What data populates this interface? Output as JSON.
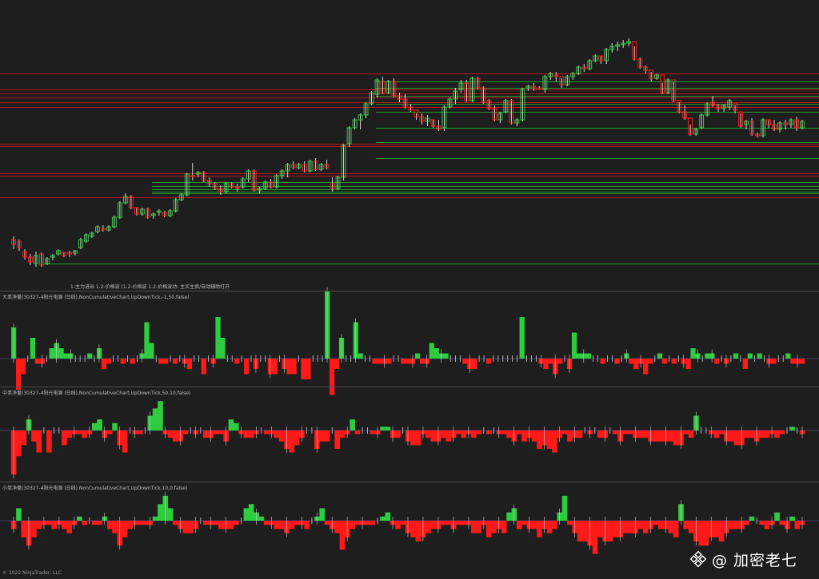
{
  "colors": {
    "background": "#1e1e1e",
    "up": "#2ecc40",
    "down": "#ff1a1a",
    "level_red": "#b8141a",
    "level_green": "#1f9a2c",
    "wick": "#d8d8d8",
    "separator": "#4a4a4a"
  },
  "price_panel": {
    "legend": "1-主力进出 1.2-价格波 (1.2-价格波 1.2-价格波动: 主买主卖/自动辅助打开"
  },
  "panels": [
    {
      "label": "大单净量(30327-4阳光电源 (日线),NonCumulativeChart,UpDownTick,-1,50,false)"
    },
    {
      "label": "中单净量(30327-4阳光电源 (日线),NonCumulativeChart,UpDownTick,50,10,false)"
    },
    {
      "label": "小单净量(30327-4阳光电源 (日线),NonCumulativeChart,UpDownTick,10,0,false)"
    }
  ],
  "footer": {
    "copyright": "© 2022 NinjaTrader, LLC"
  },
  "watermark": {
    "icon": "binance-logo-icon",
    "text": "@ 加密老七"
  },
  "chart_data": {
    "type": "candlestick",
    "grid": false,
    "candles": [
      [
        300,
        296,
        312,
        306
      ],
      [
        302,
        300,
        314,
        310
      ],
      [
        315,
        312,
        325,
        322
      ],
      [
        322,
        318,
        332,
        328
      ],
      [
        330,
        315,
        334,
        320
      ],
      [
        318,
        316,
        334,
        332
      ],
      [
        330,
        322,
        332,
        324
      ],
      [
        322,
        318,
        326,
        320
      ],
      [
        318,
        312,
        320,
        314
      ],
      [
        316,
        316,
        322,
        320
      ],
      [
        316,
        314,
        322,
        318
      ],
      [
        317,
        313,
        320,
        314
      ],
      [
        310,
        298,
        312,
        300
      ],
      [
        302,
        292,
        304,
        294
      ],
      [
        296,
        290,
        298,
        292
      ],
      [
        290,
        282,
        292,
        284
      ],
      [
        286,
        282,
        290,
        288
      ],
      [
        288,
        282,
        290,
        284
      ],
      [
        284,
        270,
        286,
        272
      ],
      [
        272,
        252,
        274,
        254
      ],
      [
        254,
        242,
        256,
        246
      ],
      [
        246,
        244,
        262,
        260
      ],
      [
        260,
        260,
        270,
        268
      ],
      [
        268,
        260,
        270,
        262
      ],
      [
        262,
        260,
        274,
        272
      ],
      [
        270,
        266,
        274,
        268
      ],
      [
        266,
        262,
        270,
        264
      ],
      [
        266,
        264,
        272,
        270
      ],
      [
        270,
        262,
        272,
        264
      ],
      [
        264,
        248,
        266,
        250
      ],
      [
        250,
        242,
        252,
        244
      ],
      [
        244,
        216,
        246,
        218
      ],
      [
        220,
        204,
        226,
        220
      ],
      [
        218,
        214,
        222,
        216
      ],
      [
        216,
        214,
        228,
        226
      ],
      [
        226,
        222,
        234,
        230
      ],
      [
        230,
        228,
        238,
        236
      ],
      [
        236,
        232,
        244,
        240
      ],
      [
        240,
        228,
        242,
        230
      ],
      [
        230,
        228,
        236,
        234
      ],
      [
        234,
        230,
        240,
        236
      ],
      [
        234,
        222,
        236,
        224
      ],
      [
        224,
        212,
        228,
        214
      ],
      [
        214,
        212,
        240,
        238
      ],
      [
        238,
        234,
        242,
        236
      ],
      [
        236,
        226,
        238,
        228
      ],
      [
        228,
        224,
        236,
        234
      ],
      [
        234,
        218,
        236,
        220
      ],
      [
        220,
        212,
        224,
        214
      ],
      [
        214,
        204,
        222,
        206
      ],
      [
        206,
        202,
        212,
        210
      ],
      [
        210,
        204,
        212,
        206
      ],
      [
        206,
        202,
        216,
        214
      ],
      [
        214,
        200,
        216,
        202
      ],
      [
        202,
        198,
        214,
        212
      ],
      [
        212,
        204,
        214,
        206
      ],
      [
        206,
        200,
        212,
        210
      ],
      [
        230,
        222,
        240,
        236
      ],
      [
        236,
        220,
        238,
        222
      ],
      [
        222,
        180,
        226,
        182
      ],
      [
        180,
        158,
        184,
        160
      ],
      [
        160,
        148,
        162,
        150
      ],
      [
        150,
        142,
        162,
        144
      ],
      [
        144,
        128,
        148,
        130
      ],
      [
        130,
        114,
        132,
        116
      ],
      [
        118,
        98,
        122,
        100
      ],
      [
        102,
        96,
        118,
        116
      ],
      [
        116,
        100,
        118,
        102
      ],
      [
        102,
        98,
        122,
        120
      ],
      [
        120,
        116,
        128,
        124
      ],
      [
        124,
        118,
        136,
        134
      ],
      [
        134,
        130,
        140,
        138
      ],
      [
        138,
        142,
        150,
        146
      ],
      [
        146,
        142,
        156,
        152
      ],
      [
        152,
        144,
        158,
        148
      ],
      [
        150,
        150,
        160,
        158
      ],
      [
        158,
        150,
        164,
        162
      ],
      [
        160,
        132,
        164,
        134
      ],
      [
        134,
        122,
        136,
        124
      ],
      [
        124,
        110,
        130,
        114
      ],
      [
        112,
        100,
        116,
        104
      ],
      [
        104,
        100,
        128,
        126
      ],
      [
        126,
        96,
        128,
        98
      ],
      [
        98,
        96,
        112,
        110
      ],
      [
        110,
        108,
        130,
        128
      ],
      [
        126,
        124,
        138,
        136
      ],
      [
        136,
        132,
        152,
        150
      ],
      [
        150,
        140,
        154,
        142
      ],
      [
        140,
        124,
        142,
        126
      ],
      [
        126,
        124,
        156,
        154
      ],
      [
        154,
        148,
        158,
        150
      ],
      [
        150,
        110,
        152,
        112
      ],
      [
        110,
        106,
        114,
        108
      ],
      [
        108,
        104,
        114,
        110
      ],
      [
        110,
        108,
        112,
        110
      ],
      [
        112,
        94,
        116,
        96
      ],
      [
        96,
        90,
        100,
        92
      ],
      [
        94,
        90,
        102,
        96
      ],
      [
        96,
        98,
        110,
        106
      ],
      [
        106,
        94,
        108,
        96
      ],
      [
        96,
        90,
        100,
        92
      ],
      [
        92,
        82,
        94,
        84
      ],
      [
        84,
        80,
        90,
        86
      ],
      [
        86,
        74,
        88,
        76
      ],
      [
        76,
        68,
        78,
        70
      ],
      [
        70,
        70,
        80,
        76
      ],
      [
        76,
        60,
        80,
        62
      ],
      [
        62,
        54,
        66,
        58
      ],
      [
        58,
        52,
        64,
        56
      ],
      [
        56,
        50,
        60,
        54
      ],
      [
        54,
        48,
        58,
        52
      ],
      [
        52,
        58,
        76,
        74
      ],
      [
        74,
        72,
        86,
        84
      ],
      [
        84,
        82,
        92,
        88
      ],
      [
        88,
        90,
        102,
        98
      ],
      [
        98,
        92,
        100,
        94
      ],
      [
        94,
        104,
        118,
        116
      ],
      [
        116,
        98,
        118,
        100
      ],
      [
        100,
        102,
        128,
        126
      ],
      [
        126,
        128,
        142,
        140
      ],
      [
        140,
        132,
        150,
        148
      ],
      [
        148,
        156,
        170,
        168
      ],
      [
        168,
        160,
        170,
        162
      ],
      [
        160,
        142,
        162,
        144
      ],
      [
        144,
        128,
        146,
        130
      ],
      [
        128,
        120,
        134,
        132
      ],
      [
        132,
        130,
        140,
        136
      ],
      [
        136,
        130,
        140,
        132
      ],
      [
        134,
        124,
        138,
        126
      ],
      [
        130,
        132,
        142,
        138
      ],
      [
        140,
        142,
        160,
        158
      ],
      [
        156,
        150,
        162,
        152
      ],
      [
        152,
        148,
        170,
        168
      ],
      [
        168,
        166,
        172,
        170
      ],
      [
        170,
        148,
        172,
        150
      ],
      [
        150,
        150,
        160,
        156
      ],
      [
        156,
        150,
        164,
        162
      ],
      [
        162,
        152,
        166,
        154
      ],
      [
        154,
        150,
        162,
        156
      ],
      [
        156,
        148,
        160,
        150
      ],
      [
        150,
        146,
        164,
        160
      ],
      [
        160,
        150,
        162,
        152
      ]
    ],
    "levels_red": [
      112,
      117,
      122,
      128,
      134,
      180,
      183,
      217,
      220,
      247,
      92
    ],
    "levels_green": [
      330,
      228,
      233,
      237,
      240,
      242,
      178,
      198,
      160,
      140,
      130,
      120,
      110,
      102
    ],
    "panels": [
      {
        "name": "大单净量",
        "values": [
          6,
          -6,
          -3,
          0,
          4,
          -1,
          -1,
          0,
          2,
          3,
          2,
          1,
          1,
          0,
          0,
          0,
          1,
          0,
          2,
          -2,
          -1,
          0,
          0,
          -1,
          0,
          -1,
          0,
          1,
          7,
          3,
          0,
          -1,
          -1,
          0,
          -1,
          0,
          -1,
          -2,
          0,
          0,
          -3,
          0,
          -1,
          8,
          4,
          0,
          0,
          -1,
          0,
          -3,
          0,
          -2,
          0,
          0,
          -3,
          -3,
          0,
          -2,
          -3,
          -3,
          0,
          -4,
          -4,
          0,
          0,
          0,
          13,
          -7,
          -2,
          4,
          0,
          0,
          7,
          1,
          0,
          0,
          -1,
          -1,
          -1,
          -1,
          0,
          0,
          -1,
          -1,
          -1,
          1,
          -1,
          -1,
          3,
          2,
          1,
          1,
          0,
          0,
          0,
          -1,
          -2,
          -2,
          0,
          0,
          -1,
          0,
          0,
          0,
          0,
          0,
          0,
          8,
          0,
          0,
          0,
          -1,
          -2,
          -1,
          -3,
          -1,
          0,
          -2,
          5,
          1,
          1,
          1,
          0,
          0,
          -1,
          0,
          0,
          -1,
          0,
          1,
          -1,
          -2,
          -1,
          -3,
          -1,
          0,
          1,
          -1,
          0,
          -1,
          0,
          -1,
          -2,
          2,
          1,
          0,
          1,
          1,
          -1,
          0,
          -1,
          0,
          1,
          0,
          -2,
          1,
          0,
          1,
          0,
          -1,
          -1,
          0,
          0,
          1,
          -1,
          -1,
          -1
        ]
      },
      {
        "name": "中单净量",
        "values": [
          -12,
          -7,
          -4,
          3,
          -3,
          -6,
          0,
          -6,
          0,
          0,
          -4,
          -2,
          -1,
          -1,
          -2,
          -1,
          2,
          3,
          -2,
          -1,
          2,
          -4,
          -6,
          0,
          -1,
          -1,
          0,
          4,
          6,
          8,
          -1,
          -2,
          -3,
          -3,
          -1,
          0,
          -1,
          0,
          -2,
          -2,
          -1,
          -1,
          -3,
          3,
          2,
          -1,
          -2,
          -2,
          -1,
          0,
          -1,
          -1,
          -2,
          -3,
          -5,
          -6,
          -4,
          -2,
          0,
          0,
          -5,
          -3,
          -3,
          0,
          -5,
          -2,
          -1,
          3,
          -1,
          0,
          0,
          -1,
          -1,
          1,
          1,
          -2,
          -2,
          0,
          -3,
          -4,
          -4,
          -1,
          -2,
          -3,
          -3,
          -2,
          -3,
          -2,
          -1,
          -2,
          -1,
          -2,
          -1,
          0,
          -1,
          0,
          -1,
          -1,
          -2,
          -3,
          -1,
          -3,
          -2,
          -3,
          -5,
          -4,
          -5,
          -6,
          -2,
          -1,
          -3,
          -2,
          -2,
          0,
          -1,
          0,
          -2,
          -2,
          0,
          -1,
          -3,
          -1,
          -1,
          -2,
          -2,
          -2,
          -3,
          -3,
          -3,
          -3,
          -3,
          -4,
          -4,
          -1,
          -2,
          4,
          0,
          0,
          -1,
          -2,
          -1,
          -3,
          -3,
          -4,
          -4,
          -2,
          -2,
          -3,
          -2,
          -2,
          -1,
          -2,
          -1,
          0,
          1,
          0,
          -1
        ]
      },
      {
        "name": "小单净量",
        "values": [
          -2,
          3,
          -4,
          -6,
          -4,
          -2,
          -1,
          -1,
          -2,
          -1,
          -2,
          -3,
          -1,
          1,
          -1,
          0,
          -1,
          -1,
          1,
          -2,
          -3,
          -6,
          -4,
          -2,
          -1,
          -1,
          -1,
          -1,
          1,
          4,
          6,
          3,
          -1,
          -2,
          -3,
          -3,
          -2,
          0,
          -1,
          -1,
          -1,
          -2,
          -2,
          -2,
          -1,
          0,
          3,
          4,
          2,
          1,
          -1,
          -1,
          -2,
          -2,
          -3,
          -2,
          -1,
          -1,
          -2,
          0,
          1,
          3,
          -1,
          -2,
          -3,
          -7,
          -4,
          -2,
          -1,
          -1,
          -1,
          -1,
          0,
          1,
          2,
          -1,
          -2,
          -1,
          -3,
          -4,
          -5,
          -4,
          -3,
          -2,
          -2,
          -1,
          -1,
          -2,
          -1,
          -1,
          -1,
          -3,
          -3,
          -1,
          -4,
          -3,
          -2,
          -3,
          2,
          3,
          -2,
          -1,
          -2,
          -2,
          -4,
          -2,
          -3,
          -2,
          2,
          6,
          -1,
          -3,
          -5,
          -5,
          -6,
          -8,
          -4,
          -5,
          -5,
          -4,
          -4,
          -3,
          -3,
          -3,
          -2,
          -3,
          -2,
          -1,
          -2,
          -2,
          -3,
          -4,
          4,
          -2,
          -3,
          -5,
          -6,
          -6,
          -4,
          -4,
          -5,
          -3,
          -2,
          -2,
          -2,
          -1,
          1,
          0,
          -1,
          -2,
          -1,
          2,
          -1,
          -2,
          1,
          -2,
          -1
        ]
      }
    ]
  }
}
